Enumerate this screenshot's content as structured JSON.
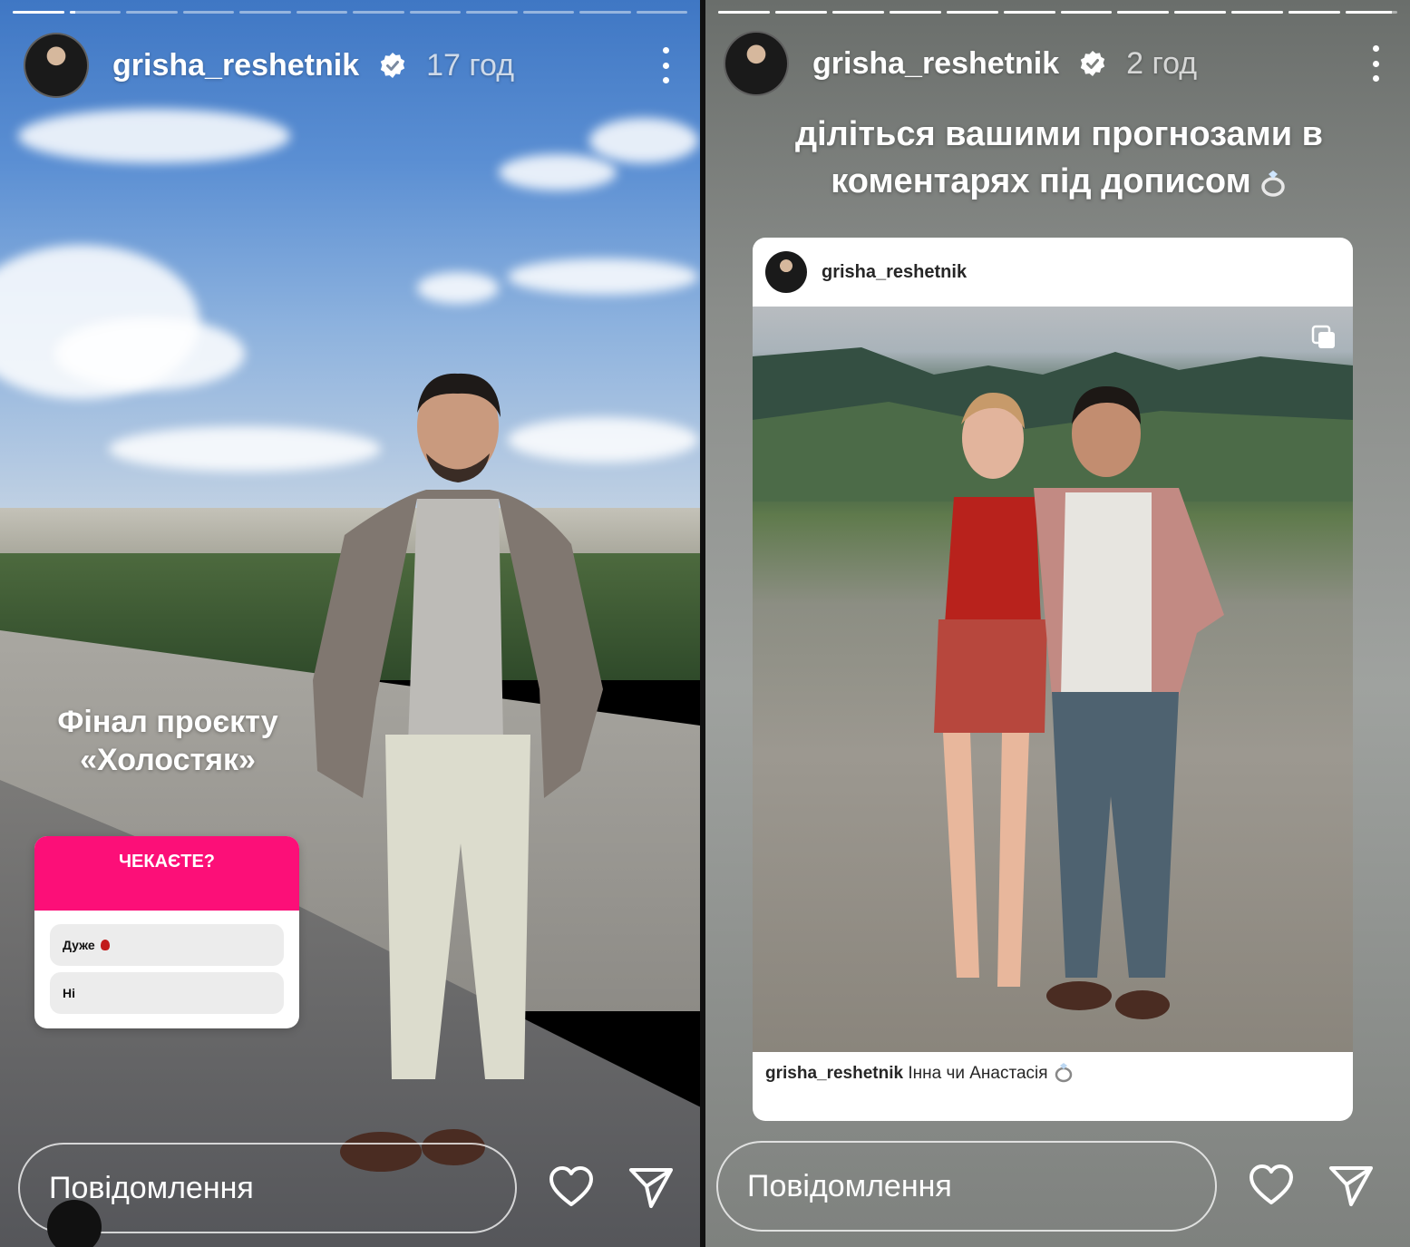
{
  "left_story": {
    "progress_segments": [
      1,
      0.12,
      0,
      0,
      0,
      0,
      0,
      0,
      0,
      0,
      0,
      0
    ],
    "username": "grisha_reshetnik",
    "time": "17 год",
    "caption": "Фінал проєкту\n«Холостяк»",
    "poll": {
      "question": "ЧЕКАЄТЕ?",
      "options": [
        "Дуже",
        "Ні"
      ]
    },
    "message_placeholder": "Повідомлення"
  },
  "right_story": {
    "progress_segments": [
      1,
      1,
      1,
      1,
      1,
      1,
      1,
      1,
      1,
      1,
      1,
      0.9
    ],
    "username": "grisha_reshetnik",
    "time": "2 год",
    "caption": "діліться вашими прогнозами в\nкоментарях під дописом",
    "shared_post": {
      "username": "grisha_reshetnik",
      "caption_user": "grisha_reshetnik",
      "caption_text": "Інна чи Анастасія"
    },
    "message_placeholder": "Повідомлення"
  },
  "colors": {
    "poll_accent": "#fc0f78",
    "verified_badge": "#ffffff"
  },
  "icons": [
    "verified-badge-icon",
    "more-options-icon",
    "heart-icon",
    "send-icon",
    "ring-icon",
    "carousel-icon",
    "rose-icon"
  ]
}
